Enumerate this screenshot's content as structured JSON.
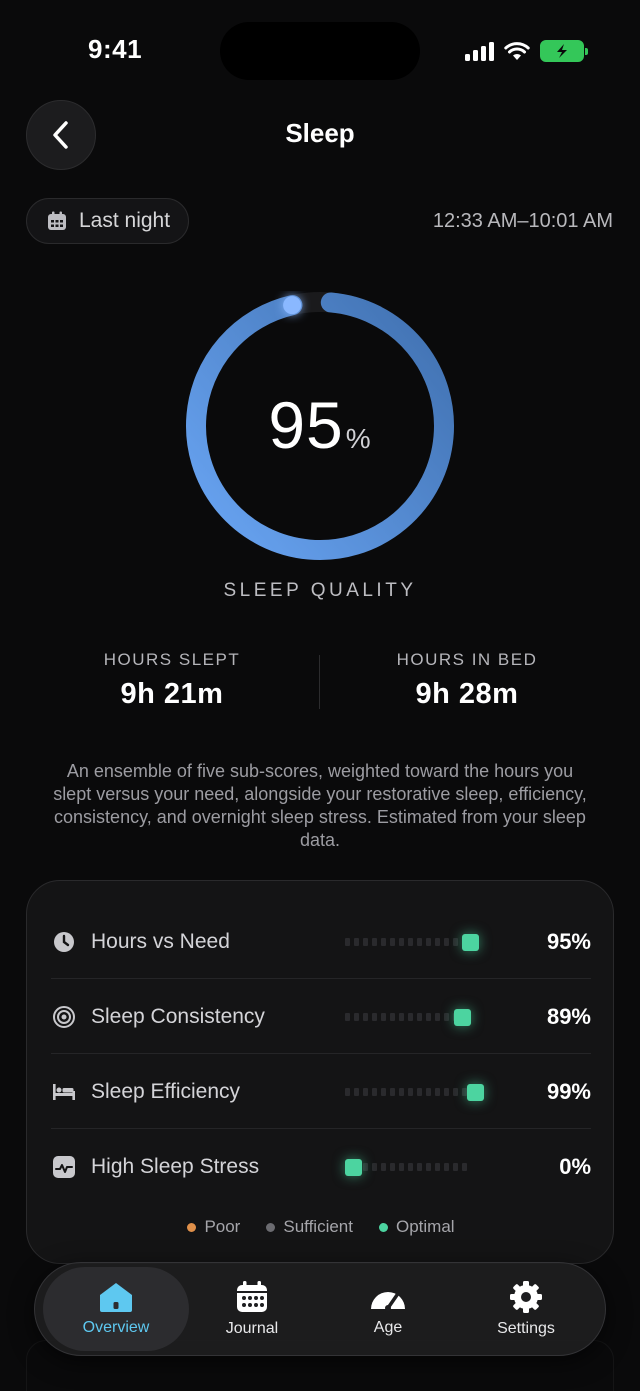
{
  "status_bar": {
    "time": "9:41"
  },
  "header": {
    "title": "Sleep"
  },
  "date_chip": {
    "label": "Last night"
  },
  "time_range": "12:33 AM–10:01 AM",
  "quality": {
    "value": "95",
    "unit": "%",
    "fraction": 0.95,
    "label": "SLEEP QUALITY"
  },
  "stats": [
    {
      "label": "HOURS SLEPT",
      "value": "9h 21m"
    },
    {
      "label": "HOURS IN BED",
      "value": "9h 28m"
    }
  ],
  "description": "An ensemble of five sub-scores, weighted toward the hours you slept versus your need, alongside your restorative sleep, efficiency, consistency, and overnight sleep stress. Estimated from your sleep data.",
  "metrics": [
    {
      "label": "Hours vs Need",
      "value": "95%",
      "icon": "clock-icon",
      "score": 0.95
    },
    {
      "label": "Sleep Consistency",
      "value": "89%",
      "icon": "target-icon",
      "score": 0.89
    },
    {
      "label": "Sleep Efficiency",
      "value": "99%",
      "icon": "bed-icon",
      "score": 0.99
    },
    {
      "label": "High Sleep Stress",
      "value": "0%",
      "icon": "pulse-icon",
      "score": 0.0
    }
  ],
  "legend": [
    {
      "label": "Poor",
      "color": "#e0904a"
    },
    {
      "label": "Sufficient",
      "color": "#6b6b70"
    },
    {
      "label": "Optimal",
      "color": "#4cd4a0"
    }
  ],
  "tabs": [
    {
      "label": "Overview",
      "icon": "home-icon",
      "active": true
    },
    {
      "label": "Journal",
      "icon": "calendar-icon",
      "active": false
    },
    {
      "label": "Age",
      "icon": "gauge-icon",
      "active": false
    },
    {
      "label": "Settings",
      "icon": "gear-icon",
      "active": false
    }
  ],
  "colors": {
    "accent": "#5ec8f0",
    "optimal": "#4cd4a0",
    "ring_start": "#6aa6f5",
    "ring_end": "#3f6fae"
  }
}
